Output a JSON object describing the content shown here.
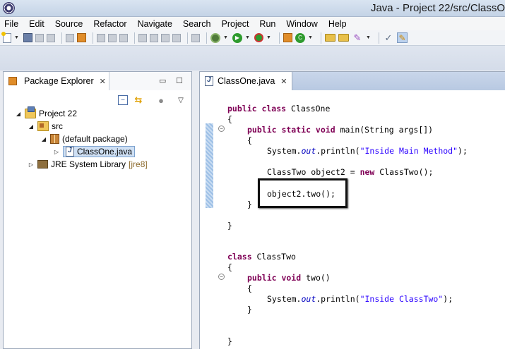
{
  "window": {
    "title": "Java - Project 22/src/ClassO"
  },
  "menu": {
    "items": [
      "File",
      "Edit",
      "Source",
      "Refactor",
      "Navigate",
      "Search",
      "Project",
      "Run",
      "Window",
      "Help"
    ]
  },
  "toolbar": {
    "icons": [
      "new-icon",
      "save-icon",
      "save-all-icon",
      "print-icon",
      "open-task-icon",
      "open-type-icon",
      "debug-icon",
      "run-icon",
      "external-tools-icon",
      "new-java-project-icon",
      "new-class-icon",
      "open-folder-icon",
      "wand-icon",
      "pin-icon",
      "brush-icon"
    ]
  },
  "package_explorer": {
    "tab_label": "Package Explorer",
    "tree": {
      "project": "Project 22",
      "src": "src",
      "package": "(default package)",
      "file": "ClassOne.java",
      "library": "JRE System Library",
      "library_decoration": "[jre8]"
    }
  },
  "editor": {
    "tab_label": "ClassOne.java",
    "code": {
      "l1_kw": "public class",
      "l1_rest": " ClassOne",
      "brace_open": "{",
      "brace_close": "}",
      "l3_kw": "public static void",
      "l3_rest": " main(String args[])",
      "l5_a": "System.",
      "l5_field": "out",
      "l5_b": ".println(",
      "l5_str": "\"Inside Main Method\"",
      "l5_c": ");",
      "l7_a": "ClassTwo object2 = ",
      "l7_kw": "new",
      "l7_b": " ClassTwo();",
      "l9": "object2.two();",
      "l12_kw": "class",
      "l12_rest": " ClassTwo",
      "l14_kw": "public void",
      "l14_rest": " two()",
      "l16_a": "System.",
      "l16_field": "out",
      "l16_b": ".println(",
      "l16_str": "\"Inside ClassTwo\"",
      "l16_c": ");"
    }
  }
}
